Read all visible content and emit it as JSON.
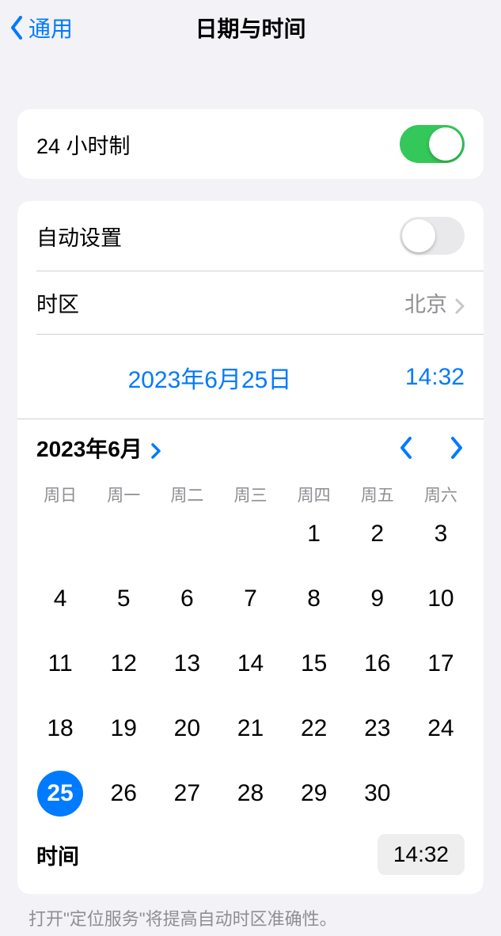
{
  "nav": {
    "back_label": "通用",
    "title": "日期与时间"
  },
  "twenty_four_hour": {
    "label": "24 小时制",
    "enabled": true
  },
  "auto_set": {
    "label": "自动设置",
    "enabled": false
  },
  "timezone": {
    "label": "时区",
    "value": "北京"
  },
  "datetime": {
    "date_display": "2023年6月25日",
    "time_display": "14:32"
  },
  "calendar": {
    "month_label": "2023年6月",
    "weekdays": [
      "周日",
      "周一",
      "周二",
      "周三",
      "周四",
      "周五",
      "周六"
    ],
    "first_weekday_index": 4,
    "days_in_month": 30,
    "selected_day": 25
  },
  "time_row": {
    "label": "时间",
    "value": "14:32"
  },
  "footer": {
    "text": "打开\"定位服务\"将提高自动时区准确性。"
  },
  "colors": {
    "accent": "#007aff",
    "toggle_on": "#34c759"
  }
}
